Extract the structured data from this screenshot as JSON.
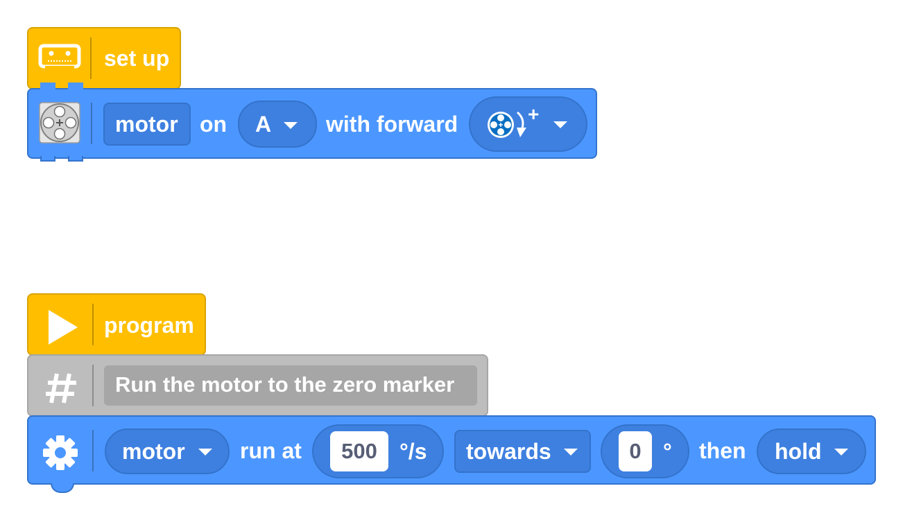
{
  "setup_block": {
    "icon": "hub-icon",
    "label": "set up"
  },
  "motor_config_block": {
    "icon": "motor-icon",
    "motor_label": "motor",
    "on_label": "on",
    "port_value": "A",
    "with_label": "with forward",
    "direction_icon": "clockwise-rotation-icon",
    "direction_sign": "+"
  },
  "program_block": {
    "icon": "play-icon",
    "label": "program"
  },
  "comment_block": {
    "icon": "hash-icon",
    "text": "Run the motor to the zero marker"
  },
  "run_block": {
    "icon": "gear-icon",
    "motor_value": "motor",
    "run_label": "run at",
    "speed_value": "500",
    "speed_unit": "°/s",
    "mode_value": "towards",
    "angle_value": "0",
    "angle_unit": "°",
    "then_label": "then",
    "stop_value": "hold"
  },
  "colors": {
    "event_yellow": "#FFBF00",
    "motor_blue": "#4C97FF",
    "comment_gray": "#BDBDBD"
  }
}
